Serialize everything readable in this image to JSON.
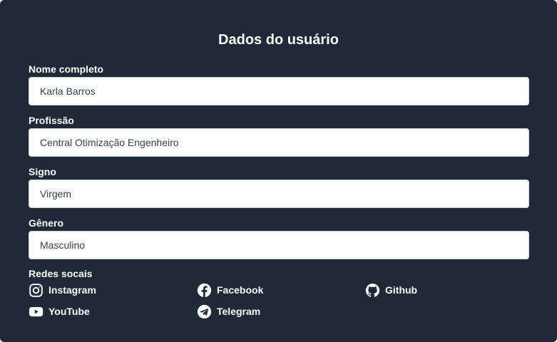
{
  "form": {
    "title": "Dados do usuário",
    "fields": [
      {
        "label": "Nome completo",
        "value": "Karla Barros"
      },
      {
        "label": "Profissão",
        "value": "Central Otimização Engenheiro"
      },
      {
        "label": "Signo",
        "value": "Virgem"
      },
      {
        "label": "Gênero",
        "value": "Masculino"
      }
    ]
  },
  "social": {
    "label": "Redes socais",
    "links": [
      {
        "label": "Instagram",
        "icon": "instagram-icon"
      },
      {
        "label": "Facebook",
        "icon": "facebook-icon"
      },
      {
        "label": "Github",
        "icon": "github-icon"
      },
      {
        "label": "YouTube",
        "icon": "youtube-icon"
      },
      {
        "label": "Telegram",
        "icon": "telegram-icon"
      }
    ]
  },
  "colors": {
    "background": "#1f2937",
    "text": "#ffffff",
    "input_background": "#ffffff",
    "input_text": "#374151"
  }
}
